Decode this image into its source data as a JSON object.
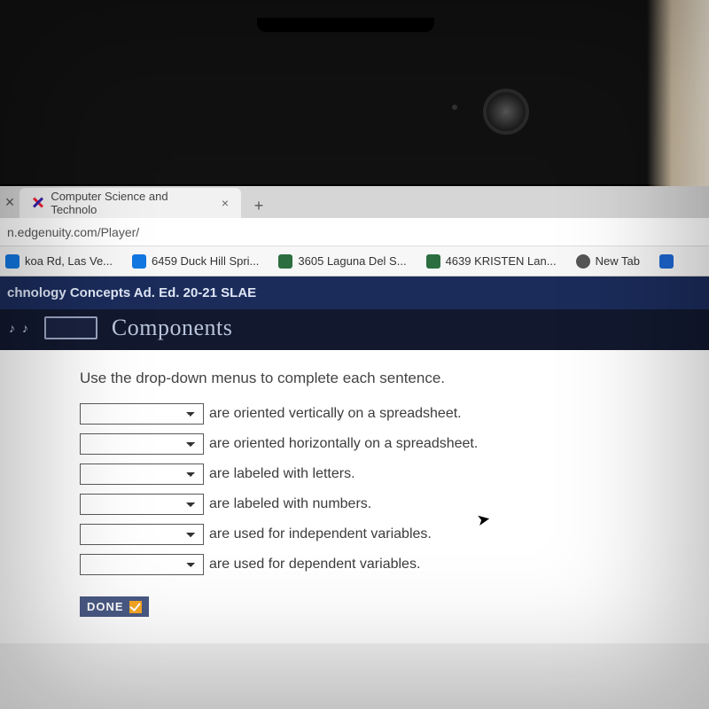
{
  "tabs": {
    "active_title": "Computer Science and Technolo"
  },
  "address_bar": {
    "url_fragment": "n.edgenuity.com/Player/"
  },
  "bookmarks": [
    {
      "label": "koa Rd, Las Ve...",
      "icon": "zillow"
    },
    {
      "label": "6459 Duck Hill Spri...",
      "icon": "zillow"
    },
    {
      "label": "3605 Laguna Del S...",
      "icon": "house"
    },
    {
      "label": "4639 KRISTEN Lan...",
      "icon": "house"
    },
    {
      "label": "New Tab",
      "icon": "globe"
    }
  ],
  "course_header": "chnology Concepts Ad. Ed. 20-21 SLAE",
  "lesson_title": "Components",
  "instruction": "Use the drop-down menus to complete each sentence.",
  "sentences": [
    "are oriented vertically on a spreadsheet.",
    "are oriented horizontally on a spreadsheet.",
    "are labeled with letters.",
    "are labeled with numbers.",
    "are used for independent variables.",
    "are used for dependent variables."
  ],
  "done_label": "DONE"
}
